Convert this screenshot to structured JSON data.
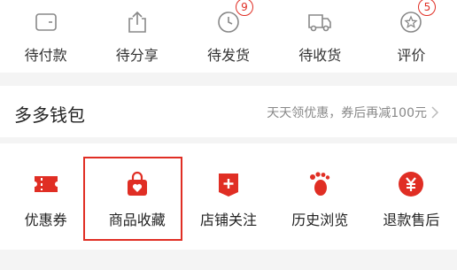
{
  "orders": [
    {
      "label": "待付款",
      "icon": "wallet-icon",
      "badge": ""
    },
    {
      "label": "待分享",
      "icon": "share-icon",
      "badge": ""
    },
    {
      "label": "待发货",
      "icon": "clock-icon",
      "badge": "9"
    },
    {
      "label": "待收货",
      "icon": "truck-icon",
      "badge": ""
    },
    {
      "label": "评价",
      "icon": "review-icon",
      "badge": "5"
    }
  ],
  "wallet": {
    "title": "多多钱包",
    "promo": "天天领优惠，券后再减100元"
  },
  "services": [
    {
      "label": "优惠券",
      "icon": "coupon-icon"
    },
    {
      "label": "商品收藏",
      "icon": "bag-heart-icon"
    },
    {
      "label": "店铺关注",
      "icon": "shop-follow-icon"
    },
    {
      "label": "历史浏览",
      "icon": "footprint-icon"
    },
    {
      "label": "退款售后",
      "icon": "refund-icon"
    }
  ],
  "colors": {
    "accent": "#e02e24",
    "icon_gray": "#888888"
  }
}
